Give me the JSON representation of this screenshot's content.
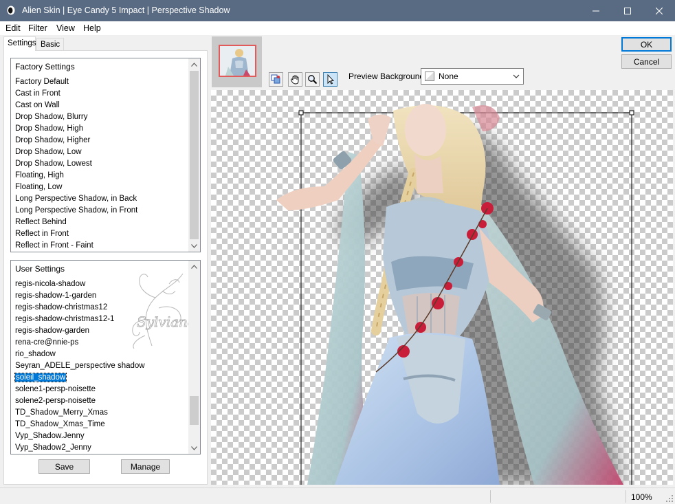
{
  "window": {
    "title": "Alien Skin | Eye Candy 5 Impact | Perspective Shadow"
  },
  "menu": [
    "Edit",
    "Filter",
    "View",
    "Help"
  ],
  "tabs": {
    "settings": "Settings",
    "basic": "Basic"
  },
  "factory_settings": {
    "header": "Factory Settings",
    "items": [
      "Factory Default",
      "Cast in Front",
      "Cast on Wall",
      "Drop Shadow, Blurry",
      "Drop Shadow, High",
      "Drop Shadow, Higher",
      "Drop Shadow, Low",
      "Drop Shadow, Lowest",
      "Floating, High",
      "Floating, Low",
      "Long Perspective Shadow, in Back",
      "Long Perspective Shadow, in Front",
      "Reflect Behind",
      "Reflect in Front",
      "Reflect in Front - Faint"
    ]
  },
  "user_settings": {
    "header": "User Settings",
    "items": [
      "regis-nicola-shadow",
      "regis-shadow-1-garden",
      "regis-shadow-christmas12",
      "regis-shadow-christmas12-1",
      "regis-shadow-garden",
      "rena-cre@nnie-ps",
      "rio_shadow",
      "Seyran_ADELE_perspective shadow",
      "soleil_shadow",
      "solene1-persp-noisette",
      "solene2-persp-noisette",
      "TD_Shadow_Merry_Xmas",
      "TD_Shadow_Xmas_Time",
      "Vyp_Shadow.Jenny",
      "Vyp_Shadow2_Jenny"
    ],
    "selected": "soleil_shadow",
    "watermark": "Sylviane"
  },
  "buttons": {
    "save": "Save",
    "manage": "Manage",
    "ok": "OK",
    "cancel": "Cancel"
  },
  "preview_background": {
    "label": "Preview Background:",
    "value": "None"
  },
  "status": {
    "zoom": "100%"
  },
  "colors": {
    "titlebar": "#596b82",
    "selection": "#0078d7",
    "thumbnail_border": "#e25a5a",
    "checker": "#cbcbcb"
  },
  "icons": [
    "alien-skin-app-icon",
    "minimize-icon",
    "maximize-icon",
    "close-icon",
    "toggle-preview-icon",
    "hand-icon",
    "zoom-icon",
    "arrow-pointer-icon",
    "chevron-down-icon",
    "chevron-up-icon"
  ]
}
